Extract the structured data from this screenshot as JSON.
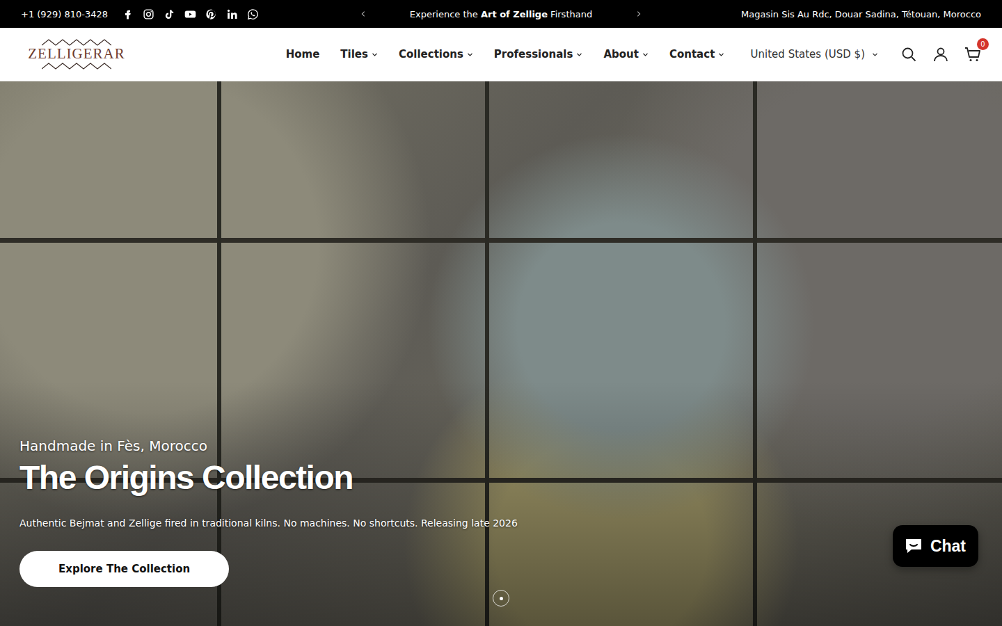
{
  "topbar": {
    "phone": "+1 (929) 810-3428",
    "announcement": [
      {
        "text": "Experience the ",
        "bold": false
      },
      {
        "text": "Art of Zellige",
        "bold": true
      },
      {
        "text": " Firsthand",
        "bold": false
      }
    ],
    "address": "Magasin Sis Au Rdc, Douar Sadina, Tétouan, Morocco"
  },
  "header": {
    "logo": "ZELLIGERAR",
    "nav": [
      {
        "label": "Home",
        "dropdown": false
      },
      {
        "label": "Tiles",
        "dropdown": true
      },
      {
        "label": "Collections",
        "dropdown": true
      },
      {
        "label": "Professionals",
        "dropdown": true
      },
      {
        "label": "About",
        "dropdown": true
      },
      {
        "label": "Contact",
        "dropdown": true
      }
    ],
    "currency": "United States (USD $)",
    "cart_count": "0"
  },
  "hero": {
    "eyebrow": "Handmade in Fès, Morocco",
    "title": "The Origins Collection",
    "text": "Authentic Bejmat and Zellige fired in traditional kilns. No machines. No shortcuts. Releasing late 2026",
    "button": "Explore The Collection",
    "slides": [
      {
        "selected": true
      }
    ]
  },
  "chat": {
    "label": "Chat"
  }
}
